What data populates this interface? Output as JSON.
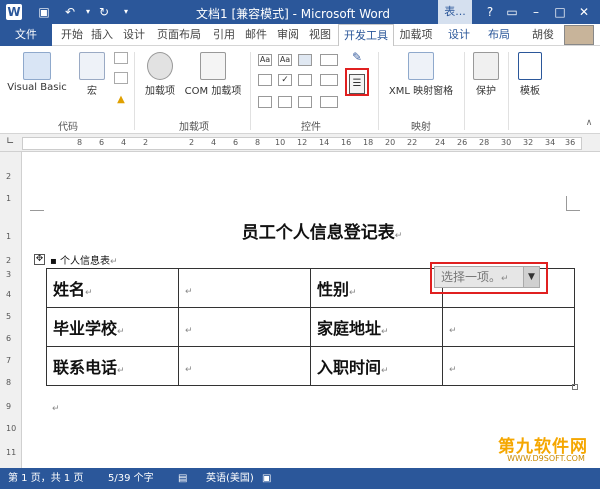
{
  "window": {
    "title": "文档1 [兼容模式] - Microsoft Word",
    "context_tab": "表...",
    "user": "胡俊"
  },
  "ribbon_tabs": {
    "file": "文件",
    "items": [
      "开始",
      "插入",
      "设计",
      "页面布局",
      "引用",
      "邮件",
      "审阅",
      "视图",
      "开发工具",
      "加载项",
      "设计",
      "布局"
    ]
  },
  "ribbon": {
    "code": {
      "label": "代码",
      "visual_basic": "Visual Basic",
      "macro": "宏"
    },
    "addins": {
      "label": "加载项",
      "addin": "加载项",
      "com_addin": "COM 加载项"
    },
    "controls": {
      "label": "控件"
    },
    "mapping": {
      "label": "映射",
      "xml_pane": "XML 映射窗格"
    },
    "protect": {
      "label": "保护"
    },
    "template": {
      "label": "模板"
    }
  },
  "ruler": {
    "h_ticks": [
      "8",
      "6",
      "4",
      "2",
      "2",
      "4",
      "6",
      "8",
      "10",
      "12",
      "14",
      "16",
      "18",
      "20",
      "22",
      "24",
      "26",
      "28",
      "30",
      "32",
      "34",
      "36",
      "38"
    ],
    "v_ticks": [
      "2",
      "1",
      "1",
      "2",
      "3",
      "4",
      "5",
      "6",
      "7",
      "8",
      "9",
      "10",
      "11"
    ]
  },
  "document": {
    "heading": "员工个人信息登记表",
    "table_caption": "个人信息表",
    "rows": [
      {
        "c1": "姓名",
        "c2": "",
        "c3": "性别",
        "c4": ""
      },
      {
        "c1": "毕业学校",
        "c2": "",
        "c3": "家庭地址",
        "c4": ""
      },
      {
        "c1": "联系电话",
        "c2": "",
        "c3": "入职时间",
        "c4": ""
      }
    ],
    "dropdown_placeholder": "选择一项。"
  },
  "status": {
    "page": "第 1 页，共 1 页",
    "words": "5/39 个字",
    "language": "英语(美国)"
  },
  "watermark": {
    "brand": "第九软件网",
    "url": "WWW.D9SOFT.COM"
  },
  "colors": {
    "accent": "#2b579a",
    "highlight": "#e02020",
    "watermark": "#f5a700"
  }
}
